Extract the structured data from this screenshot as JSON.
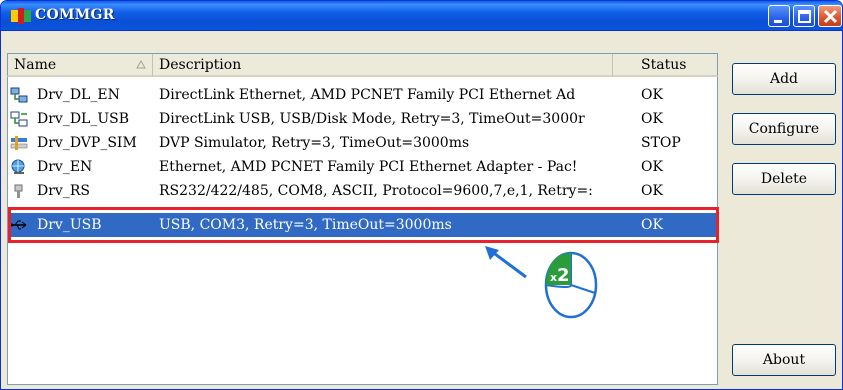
{
  "window": {
    "title": "COMMGR",
    "icon": "commgr-app-icon"
  },
  "titlebar_buttons": {
    "minimize_icon": "minimize-icon",
    "maximize_icon": "maximize-icon",
    "close_icon": "close-icon"
  },
  "list": {
    "columns": {
      "name": "Name",
      "description": "Description",
      "status": "Status"
    },
    "rows": [
      {
        "icon": "ethernet-network-icon",
        "name": "Drv_DL_EN",
        "description": "DirectLink Ethernet, AMD PCNET Family PCI Ethernet Ad",
        "status": "OK"
      },
      {
        "icon": "usb-network-icon",
        "name": "Drv_DL_USB",
        "description": "DirectLink USB, USB/Disk Mode, Retry=3, TimeOut=3000r",
        "status": "OK"
      },
      {
        "icon": "simulator-icon",
        "name": "Drv_DVP_SIM",
        "description": "DVP Simulator, Retry=3, TimeOut=3000ms",
        "status": "STOP"
      },
      {
        "icon": "ethernet-globe-icon",
        "name": "Drv_EN",
        "description": "Ethernet, AMD PCNET Family PCI Ethernet Adapter - Pac!",
        "status": "OK"
      },
      {
        "icon": "serial-port-icon",
        "name": "Drv_RS",
        "description": "RS232/422/485, COM8, ASCII, Protocol=9600,7,e,1, Retry=:",
        "status": "OK"
      },
      {
        "icon": "usb-icon",
        "name": "Drv_USB",
        "description": "USB, COM3, Retry=3, TimeOut=3000ms",
        "status": "OK",
        "selected": true
      }
    ]
  },
  "buttons": {
    "add": "Add",
    "configure": "Configure",
    "delete": "Delete",
    "about": "About"
  },
  "annotation": {
    "mouse_label": "x2",
    "accent_color": "#e8222c",
    "arrow_color": "#1f6fd8"
  },
  "colors": {
    "selection": "#316ac5",
    "titlebar": "#0a4fd6"
  }
}
